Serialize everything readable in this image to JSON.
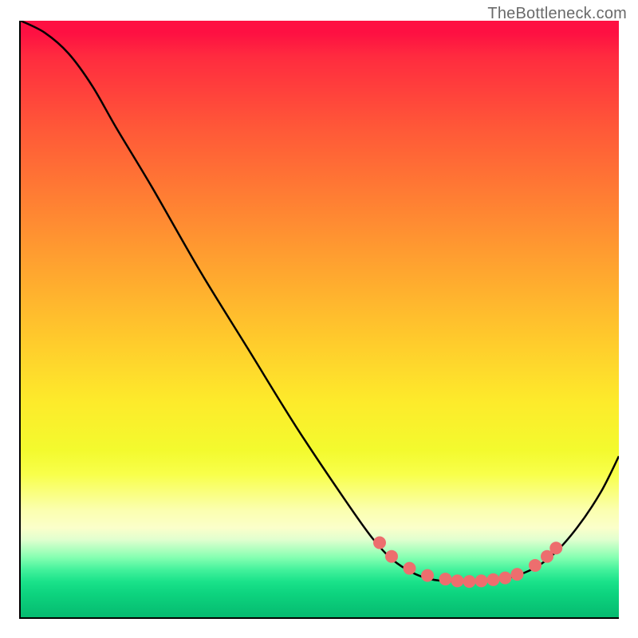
{
  "watermark": "TheBottleneck.com",
  "chart_data": {
    "type": "line",
    "title": "",
    "xlabel": "",
    "ylabel": "",
    "xlim": [
      0,
      100
    ],
    "ylim": [
      0,
      100
    ],
    "grid": false,
    "gradient_colors": {
      "top": "#fe1042",
      "mid_upper": "#ff7f33",
      "mid": "#fdeb2b",
      "mid_lower": "#fbffca",
      "bottom": "#06bb70"
    },
    "series": [
      {
        "name": "bottleneck-curve",
        "color": "#000000",
        "points": [
          {
            "x": 0,
            "y": 100
          },
          {
            "x": 4,
            "y": 98
          },
          {
            "x": 8,
            "y": 94.5
          },
          {
            "x": 12,
            "y": 89
          },
          {
            "x": 16,
            "y": 82
          },
          {
            "x": 22,
            "y": 72
          },
          {
            "x": 30,
            "y": 58
          },
          {
            "x": 38,
            "y": 45
          },
          {
            "x": 46,
            "y": 32
          },
          {
            "x": 54,
            "y": 20
          },
          {
            "x": 59,
            "y": 13
          },
          {
            "x": 63,
            "y": 9
          },
          {
            "x": 68,
            "y": 6.5
          },
          {
            "x": 74,
            "y": 6
          },
          {
            "x": 80,
            "y": 6.3
          },
          {
            "x": 85,
            "y": 7.8
          },
          {
            "x": 89,
            "y": 10.5
          },
          {
            "x": 93,
            "y": 15
          },
          {
            "x": 97,
            "y": 21
          },
          {
            "x": 100,
            "y": 27
          }
        ]
      },
      {
        "name": "optimal-range-markers",
        "color": "#ed6e6e",
        "type": "scatter",
        "points": [
          {
            "x": 60,
            "y": 12.5
          },
          {
            "x": 62,
            "y": 10.2
          },
          {
            "x": 65,
            "y": 8.2
          },
          {
            "x": 68,
            "y": 7.0
          },
          {
            "x": 71,
            "y": 6.4
          },
          {
            "x": 73,
            "y": 6.1
          },
          {
            "x": 75,
            "y": 6.0
          },
          {
            "x": 77,
            "y": 6.1
          },
          {
            "x": 79,
            "y": 6.3
          },
          {
            "x": 81,
            "y": 6.6
          },
          {
            "x": 83,
            "y": 7.2
          },
          {
            "x": 86,
            "y": 8.7
          },
          {
            "x": 88,
            "y": 10.2
          },
          {
            "x": 89.5,
            "y": 11.6
          }
        ]
      }
    ],
    "optimal_x_range": [
      60,
      89
    ]
  }
}
